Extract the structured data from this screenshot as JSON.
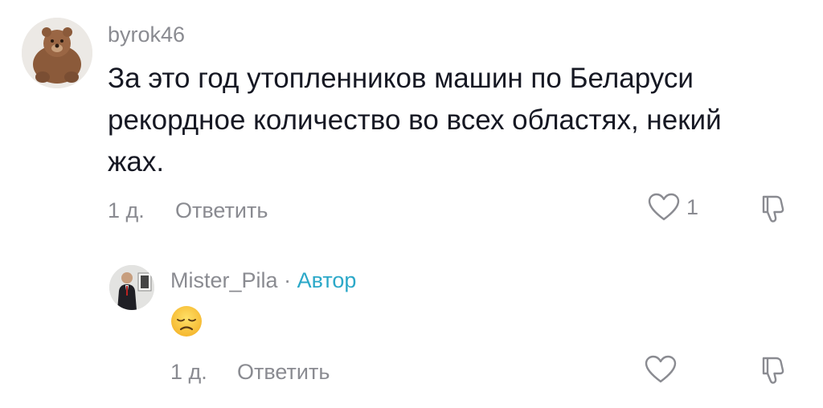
{
  "comments": [
    {
      "username": "byrok46",
      "text_lines": [
        "За это год утопленников машин по Беларуси",
        "рекордное количество во всех областях, некий",
        "жах."
      ],
      "time": "1 д.",
      "reply_label": "Ответить",
      "like_count": "1",
      "avatar_icon": "bear-avatar"
    },
    {
      "username": "Mister_Pila",
      "author_separator": "·",
      "author_badge": "Автор",
      "emoji_icon": "disappointed-face-emoji",
      "time": "1 д.",
      "reply_label": "Ответить",
      "avatar_icon": "man-photo-avatar"
    }
  ],
  "colors": {
    "meta_gray": "#8a8b91",
    "text": "#161823",
    "author_accent": "#2ba8c8"
  }
}
